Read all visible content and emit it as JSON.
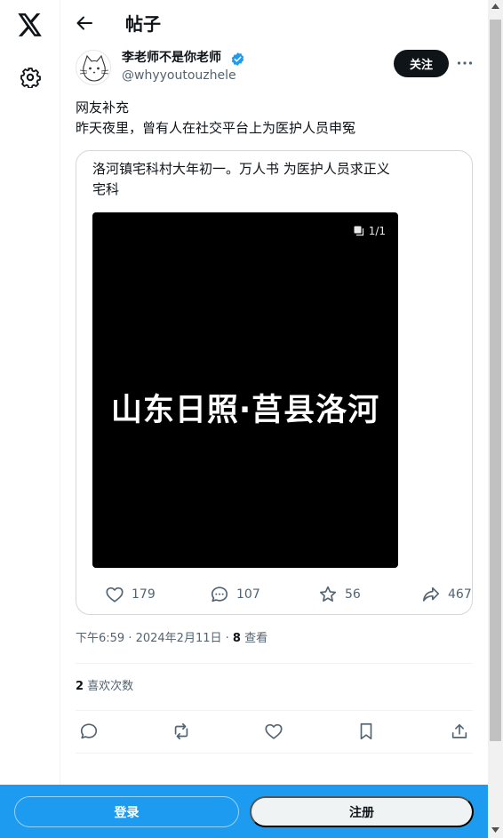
{
  "nav": {
    "logo_icon": "x-logo-icon",
    "settings_icon": "gear-icon"
  },
  "header": {
    "title": "帖子"
  },
  "author": {
    "name": "李老师不是你老师",
    "handle": "@whyyoutouzhele",
    "verified": true,
    "follow_label": "关注"
  },
  "post": {
    "lines": [
      "网友补充",
      "昨天夜里，曾有人在社交平台上为医护人员申冤"
    ]
  },
  "quote": {
    "lines": [
      "洛河镇宅科村大年初一。万人书 为医护人员求正义",
      "宅科"
    ],
    "media_counter": "1/1",
    "video_caption": "山东日照·莒县洛河",
    "stats": {
      "likes": "179",
      "replies": "107",
      "bookmarks": "56",
      "shares": "467"
    }
  },
  "meta": {
    "time_date": "下午6:59 · 2024年2月11日 · ",
    "views_count": "8",
    "views_label": " 查看"
  },
  "likes": {
    "count": "2",
    "label": " 喜欢次数"
  },
  "bottom_bar": {
    "login_label": "登录",
    "signup_label": "注册"
  },
  "colors": {
    "accent": "#1d9bf0",
    "text": "#0f1419",
    "muted": "#536471"
  }
}
